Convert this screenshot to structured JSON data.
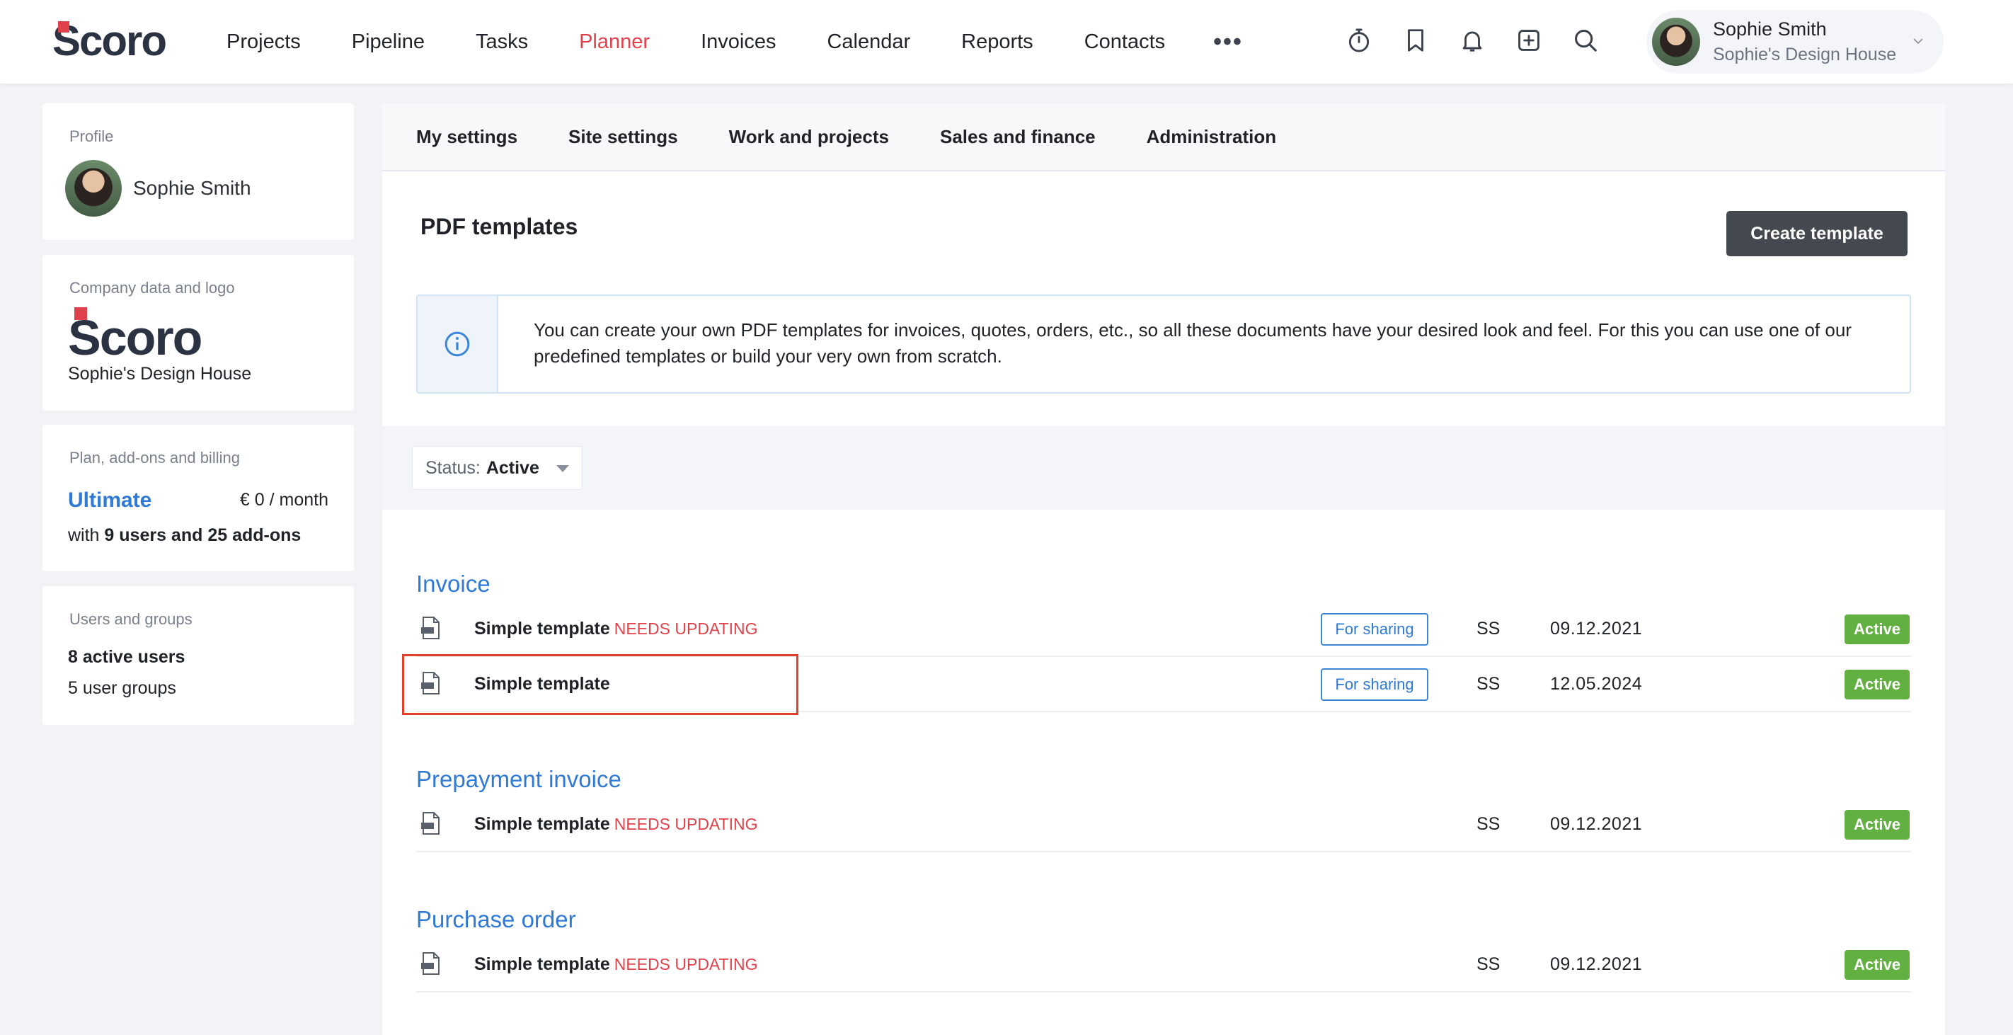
{
  "brand": {
    "logo_text": "Scoro",
    "accent": "#e0424b",
    "link_color": "#2e7ad6",
    "active_badge_color": "#62b042"
  },
  "nav": {
    "items": [
      "Projects",
      "Pipeline",
      "Tasks",
      "Planner",
      "Invoices",
      "Calendar",
      "Reports",
      "Contacts"
    ],
    "active": "Planner",
    "more_icon": "more-dots-icon",
    "icons": [
      "timer-icon",
      "bookmark-icon",
      "bell-icon",
      "add-square-icon",
      "search-icon"
    ]
  },
  "user": {
    "name": "Sophie Smith",
    "company": "Sophie's Design House"
  },
  "sidebar": {
    "profile": {
      "label": "Profile",
      "name": "Sophie Smith"
    },
    "company": {
      "label": "Company data and logo",
      "logo_text": "Scoro",
      "name": "Sophie's Design House"
    },
    "plan": {
      "label": "Plan, add-ons and billing",
      "name": "Ultimate",
      "price": "€ 0 / month",
      "users_prefix": "with",
      "users_text": "9 users and 25 add-ons"
    },
    "users": {
      "label": "Users and groups",
      "active_users": "8 active users",
      "user_groups": "5 user groups"
    }
  },
  "tabs": [
    "My settings",
    "Site settings",
    "Work and projects",
    "Sales and finance",
    "Administration"
  ],
  "page": {
    "title": "PDF templates",
    "create_button": "Create template",
    "info_text": "You can create your own PDF templates for invoices, quotes, orders, etc., so all these documents have your desired look and feel. For this you can use one of our predefined templates or build your very own from scratch."
  },
  "filter": {
    "label": "Status:",
    "value": "Active"
  },
  "sections": [
    {
      "title": "Invoice",
      "rows": [
        {
          "name": "Simple template",
          "flag": "NEEDS UPDATING",
          "sharing": "For sharing",
          "author": "SS",
          "date": "09.12.2021",
          "status": "Active"
        },
        {
          "name": "Simple template",
          "flag": "",
          "sharing": "For sharing",
          "author": "SS",
          "date": "12.05.2024",
          "status": "Active"
        }
      ]
    },
    {
      "title": "Prepayment invoice",
      "rows": [
        {
          "name": "Simple template",
          "flag": "NEEDS UPDATING",
          "sharing": "",
          "author": "SS",
          "date": "09.12.2021",
          "status": "Active"
        }
      ]
    },
    {
      "title": "Purchase order",
      "rows": [
        {
          "name": "Simple template",
          "flag": "NEEDS UPDATING",
          "sharing": "",
          "author": "SS",
          "date": "09.12.2021",
          "status": "Active"
        }
      ]
    }
  ]
}
